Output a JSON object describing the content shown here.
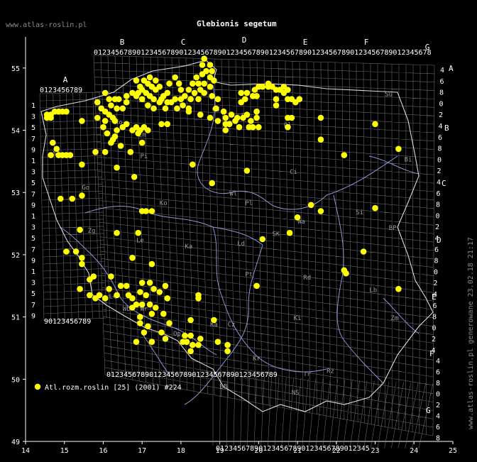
{
  "title": "Glebionis segetum",
  "site": "www.atlas-roslin.pl",
  "generated": "www.atlas-roslin.pl generowane 23.02.18 21:17",
  "legend_label": "Atl.rozm.roslin [25] (2001) #224",
  "colors": {
    "dot": "#ffff00",
    "grid": "#8a8a8a",
    "river": "#8c95d6",
    "border": "#ffffff"
  },
  "chart_data": {
    "type": "scatter",
    "xlim": [
      14,
      25
    ],
    "ylim": [
      49,
      55.5
    ],
    "x_ticks": [
      "14",
      "15",
      "16",
      "17",
      "18",
      "19",
      "20",
      "21",
      "22",
      "23",
      "24",
      "25"
    ],
    "y_ticks": [
      "49",
      "50",
      "51",
      "52",
      "53",
      "54",
      "55"
    ],
    "zones_top": [
      "A",
      "B",
      "C",
      "D",
      "E",
      "F",
      "G"
    ],
    "zones_right": [
      "A",
      "B",
      "C",
      "D",
      "E",
      "F",
      "G"
    ],
    "top_digits": "0123456789012345678901234567890123456789012345678901234567890123456789012345678",
    "bottom_digits_left": "0123456789012345678901234567890123456789",
    "bottom_digits_right": "012345678901234567890123456789012345",
    "a_digits": "0123456789",
    "a_bottom_digits": "90123456789",
    "left_row_labels": [
      "1",
      "3",
      "5",
      "7",
      "9",
      "1",
      "3",
      "5",
      "7",
      "9",
      "1",
      "3",
      "5",
      "7",
      "9",
      "1",
      "3",
      "5",
      "7",
      "9"
    ],
    "right_row_labels": [
      "4",
      "6",
      "8",
      "0",
      "2",
      "4",
      "6",
      "8",
      "0",
      "2",
      "4",
      "6",
      "8",
      "0",
      "2",
      "4",
      "6",
      "8",
      "0",
      "2",
      "4",
      "6",
      "8",
      "0",
      "2",
      "4"
    ],
    "right_bottom_labels": [
      "4",
      "6",
      "8",
      "0",
      "2",
      "4",
      "6",
      "8"
    ],
    "regions": [
      {
        "t": "Su",
        "x": 23.25,
        "y": 54.55
      },
      {
        "t": "Bi",
        "x": 23.75,
        "y": 53.5
      },
      {
        "t": "Ci",
        "x": 20.8,
        "y": 53.3
      },
      {
        "t": "Pi",
        "x": 16.95,
        "y": 53.55
      },
      {
        "t": "Ko",
        "x": 17.45,
        "y": 52.8
      },
      {
        "t": "Zg",
        "x": 15.6,
        "y": 52.35
      },
      {
        "t": "Le",
        "x": 16.85,
        "y": 52.2
      },
      {
        "t": "Ka",
        "x": 18.1,
        "y": 52.1
      },
      {
        "t": "Ld",
        "x": 19.45,
        "y": 52.15
      },
      {
        "t": "SK",
        "x": 20.35,
        "y": 52.3
      },
      {
        "t": "Si",
        "x": 22.5,
        "y": 52.65
      },
      {
        "t": "BP",
        "x": 23.35,
        "y": 52.4
      },
      {
        "t": "Pt",
        "x": 19.65,
        "y": 51.65
      },
      {
        "t": "Rd",
        "x": 21.15,
        "y": 51.6
      },
      {
        "t": "Lb",
        "x": 22.85,
        "y": 51.4
      },
      {
        "t": "Wb",
        "x": 16.5,
        "y": 51.1
      },
      {
        "t": "Ki",
        "x": 20.9,
        "y": 50.95
      },
      {
        "t": "Zm",
        "x": 23.4,
        "y": 50.95
      },
      {
        "t": "Tr",
        "x": 21.15,
        "y": 50.05
      },
      {
        "t": "Rz",
        "x": 21.75,
        "y": 50.1
      },
      {
        "t": "NS",
        "x": 20.85,
        "y": 49.75
      },
      {
        "t": "BB",
        "x": 19.0,
        "y": 49.85
      },
      {
        "t": "Gd",
        "x": 18.8,
        "y": 54.3
      },
      {
        "t": "El",
        "x": 19.55,
        "y": 54.2
      },
      {
        "t": "Ol",
        "x": 20.65,
        "y": 54.05
      },
      {
        "t": "Sz",
        "x": 14.7,
        "y": 53.6
      },
      {
        "t": "Go",
        "x": 15.45,
        "y": 53.05
      },
      {
        "t": "Wa",
        "x": 21.0,
        "y": 52.5
      },
      {
        "t": "Pl",
        "x": 19.65,
        "y": 52.8
      },
      {
        "t": "Wl",
        "x": 19.25,
        "y": 52.95
      },
      {
        "t": "Ka",
        "x": 18.75,
        "y": 50.85
      },
      {
        "t": "Kr",
        "x": 19.85,
        "y": 50.3
      },
      {
        "t": "Cz",
        "x": 19.2,
        "y": 50.85
      },
      {
        "t": "Op",
        "x": 17.8,
        "y": 50.7
      },
      {
        "t": "Wr",
        "x": 16.95,
        "y": 51.1
      },
      {
        "t": "Le",
        "x": 16.15,
        "y": 51.3
      },
      {
        "t": "Lm",
        "x": 16.9,
        "y": 53.9
      },
      {
        "t": "SI",
        "x": 16.9,
        "y": 54.45
      },
      {
        "t": "Ko",
        "x": 16.3,
        "y": 54.1
      }
    ],
    "points": [
      [
        14.75,
        54.3
      ],
      [
        14.55,
        54.25
      ],
      [
        14.65,
        54.25
      ],
      [
        14.85,
        54.3
      ],
      [
        14.95,
        54.3
      ],
      [
        15.05,
        54.3
      ],
      [
        14.55,
        54.2
      ],
      [
        14.65,
        54.2
      ],
      [
        14.7,
        53.8
      ],
      [
        14.8,
        53.7
      ],
      [
        14.65,
        53.6
      ],
      [
        14.85,
        53.6
      ],
      [
        14.95,
        53.6
      ],
      [
        15.05,
        53.6
      ],
      [
        15.15,
        53.6
      ],
      [
        15.45,
        54.15
      ],
      [
        15.85,
        54.45
      ],
      [
        15.8,
        53.65
      ],
      [
        15.45,
        53.45
      ],
      [
        14.9,
        52.9
      ],
      [
        15.2,
        52.9
      ],
      [
        15.45,
        52.95
      ],
      [
        16.05,
        54.6
      ],
      [
        16.15,
        54.5
      ],
      [
        16.3,
        54.5
      ],
      [
        16.4,
        54.5
      ],
      [
        16.2,
        54.4
      ],
      [
        16.35,
        54.35
      ],
      [
        16.5,
        54.35
      ],
      [
        16.6,
        54.45
      ],
      [
        16.6,
        54.55
      ],
      [
        16.75,
        54.6
      ],
      [
        16.85,
        54.55
      ],
      [
        16.95,
        54.7
      ],
      [
        16.85,
        54.8
      ],
      [
        17.05,
        54.8
      ],
      [
        17.2,
        54.85
      ],
      [
        17.15,
        54.75
      ],
      [
        17.0,
        54.65
      ],
      [
        17.25,
        54.7
      ],
      [
        17.35,
        54.8
      ],
      [
        17.35,
        54.65
      ],
      [
        17.45,
        54.7
      ],
      [
        17.55,
        54.55
      ],
      [
        17.65,
        54.6
      ],
      [
        17.7,
        54.75
      ],
      [
        17.85,
        54.85
      ],
      [
        17.95,
        54.75
      ],
      [
        18.0,
        54.65
      ],
      [
        18.1,
        54.55
      ],
      [
        18.2,
        54.65
      ],
      [
        18.3,
        54.75
      ],
      [
        18.35,
        54.6
      ],
      [
        18.45,
        54.75
      ],
      [
        18.4,
        54.85
      ],
      [
        18.55,
        54.9
      ],
      [
        18.55,
        55.05
      ],
      [
        18.65,
        54.95
      ],
      [
        18.75,
        54.85
      ],
      [
        18.6,
        54.75
      ],
      [
        18.5,
        54.65
      ],
      [
        18.45,
        54.5
      ],
      [
        18.25,
        54.5
      ],
      [
        18.0,
        54.5
      ],
      [
        17.85,
        54.5
      ],
      [
        17.75,
        54.45
      ],
      [
        17.65,
        54.45
      ],
      [
        17.5,
        54.5
      ],
      [
        17.3,
        54.5
      ],
      [
        17.2,
        54.55
      ],
      [
        17.1,
        54.6
      ],
      [
        16.9,
        54.6
      ],
      [
        17.0,
        54.5
      ],
      [
        17.15,
        54.4
      ],
      [
        17.3,
        54.35
      ],
      [
        17.45,
        54.45
      ],
      [
        17.6,
        54.35
      ],
      [
        17.9,
        54.35
      ],
      [
        18.05,
        54.4
      ],
      [
        18.2,
        54.35
      ],
      [
        18.6,
        55.15
      ],
      [
        18.75,
        55.05
      ],
      [
        18.8,
        54.95
      ],
      [
        18.85,
        54.8
      ],
      [
        18.75,
        54.7
      ],
      [
        18.6,
        54.6
      ],
      [
        18.8,
        54.55
      ],
      [
        18.95,
        54.5
      ],
      [
        18.9,
        54.35
      ],
      [
        18.5,
        54.25
      ],
      [
        18.2,
        54.3
      ],
      [
        18.75,
        54.2
      ],
      [
        18.95,
        54.15
      ],
      [
        19.1,
        54.3
      ],
      [
        19.15,
        54.2
      ],
      [
        19.25,
        54.1
      ],
      [
        19.3,
        54.25
      ],
      [
        19.4,
        54.15
      ],
      [
        19.5,
        54.05
      ],
      [
        19.45,
        54.2
      ],
      [
        19.6,
        54.2
      ],
      [
        19.7,
        54.25
      ],
      [
        19.8,
        54.15
      ],
      [
        19.85,
        54.05
      ],
      [
        19.95,
        54.2
      ],
      [
        19.95,
        54.3
      ],
      [
        19.55,
        54.45
      ],
      [
        19.55,
        54.6
      ],
      [
        19.7,
        54.6
      ],
      [
        19.65,
        54.5
      ],
      [
        19.15,
        54.0
      ],
      [
        19.15,
        54.1
      ],
      [
        19.75,
        54.05
      ],
      [
        20.0,
        54.05
      ],
      [
        19.95,
        54.55
      ],
      [
        19.9,
        54.65
      ],
      [
        19.85,
        54.55
      ],
      [
        20.0,
        54.7
      ],
      [
        20.1,
        54.7
      ],
      [
        20.25,
        54.7
      ],
      [
        20.25,
        54.75
      ],
      [
        20.35,
        54.7
      ],
      [
        20.45,
        54.65
      ],
      [
        20.55,
        54.65
      ],
      [
        20.65,
        54.7
      ],
      [
        20.75,
        54.65
      ],
      [
        20.65,
        54.6
      ],
      [
        20.45,
        54.5
      ],
      [
        20.75,
        54.5
      ],
      [
        20.85,
        54.5
      ],
      [
        21.05,
        54.5
      ],
      [
        20.45,
        54.4
      ],
      [
        20.75,
        54.2
      ],
      [
        20.85,
        54.2
      ],
      [
        20.95,
        54.45
      ],
      [
        20.75,
        54.05
      ],
      [
        21.6,
        54.2
      ],
      [
        21.6,
        53.85
      ],
      [
        22.2,
        53.6
      ],
      [
        23.0,
        54.1
      ],
      [
        23.6,
        53.7
      ],
      [
        22.2,
        51.75
      ],
      [
        22.25,
        51.7
      ],
      [
        22.7,
        52.05
      ],
      [
        23.6,
        51.45
      ],
      [
        23.0,
        52.75
      ],
      [
        21.35,
        52.8
      ],
      [
        21.6,
        52.7
      ],
      [
        21.0,
        52.6
      ],
      [
        20.8,
        52.35
      ],
      [
        20.1,
        52.25
      ],
      [
        19.7,
        53.35
      ],
      [
        18.8,
        53.15
      ],
      [
        18.3,
        53.45
      ],
      [
        17.25,
        52.7
      ],
      [
        17.1,
        52.7
      ],
      [
        17.0,
        52.7
      ],
      [
        16.8,
        53.25
      ],
      [
        16.35,
        53.4
      ],
      [
        16.05,
        53.65
      ],
      [
        16.2,
        53.8
      ],
      [
        16.3,
        53.9
      ],
      [
        16.35,
        54.0
      ],
      [
        16.5,
        54.05
      ],
      [
        16.6,
        54.1
      ],
      [
        16.75,
        54.0
      ],
      [
        16.85,
        54.05
      ],
      [
        16.95,
        54.0
      ],
      [
        17.05,
        54.05
      ],
      [
        17.15,
        54.0
      ],
      [
        16.9,
        53.95
      ],
      [
        17.0,
        53.8
      ],
      [
        16.7,
        53.65
      ],
      [
        16.45,
        53.75
      ],
      [
        16.25,
        53.85
      ],
      [
        16.1,
        53.95
      ],
      [
        16.0,
        54.05
      ],
      [
        16.05,
        54.15
      ],
      [
        16.15,
        54.25
      ],
      [
        16.25,
        54.2
      ],
      [
        16.3,
        54.15
      ],
      [
        15.85,
        54.2
      ],
      [
        15.95,
        54.35
      ],
      [
        16.05,
        54.3
      ],
      [
        17.5,
        54.1
      ],
      [
        17.65,
        54.1
      ],
      [
        16.9,
        52.35
      ],
      [
        16.75,
        51.95
      ],
      [
        17.25,
        51.85
      ],
      [
        16.45,
        51.5
      ],
      [
        16.6,
        51.5
      ],
      [
        17.0,
        51.55
      ],
      [
        17.2,
        51.55
      ],
      [
        17.3,
        51.45
      ],
      [
        17.45,
        51.4
      ],
      [
        17.6,
        51.5
      ],
      [
        17.65,
        51.3
      ],
      [
        17.1,
        51.35
      ],
      [
        16.95,
        51.4
      ],
      [
        16.75,
        51.3
      ],
      [
        16.65,
        51.35
      ],
      [
        16.85,
        51.2
      ],
      [
        16.75,
        51.15
      ],
      [
        17.0,
        51.2
      ],
      [
        17.2,
        51.2
      ],
      [
        17.35,
        51.15
      ],
      [
        16.95,
        51.0
      ],
      [
        17.25,
        51.05
      ],
      [
        17.55,
        51.05
      ],
      [
        17.7,
        50.9
      ],
      [
        17.5,
        50.75
      ],
      [
        17.15,
        50.85
      ],
      [
        16.95,
        50.9
      ],
      [
        17.05,
        50.75
      ],
      [
        17.6,
        50.65
      ],
      [
        17.25,
        50.6
      ],
      [
        16.85,
        50.6
      ],
      [
        18.05,
        50.6
      ],
      [
        18.1,
        50.7
      ],
      [
        18.25,
        50.7
      ],
      [
        18.15,
        50.6
      ],
      [
        18.3,
        50.55
      ],
      [
        18.25,
        50.45
      ],
      [
        18.45,
        50.55
      ],
      [
        18.5,
        50.65
      ],
      [
        18.25,
        50.95
      ],
      [
        18.45,
        51.3
      ],
      [
        18.45,
        51.35
      ],
      [
        18.85,
        50.95
      ],
      [
        18.95,
        50.6
      ],
      [
        19.2,
        50.55
      ],
      [
        19.2,
        50.45
      ],
      [
        19.95,
        51.5
      ],
      [
        15.05,
        52.05
      ],
      [
        15.3,
        52.05
      ],
      [
        15.45,
        51.85
      ],
      [
        15.45,
        51.95
      ],
      [
        15.4,
        51.45
      ],
      [
        15.65,
        51.6
      ],
      [
        15.75,
        51.65
      ],
      [
        15.65,
        51.35
      ],
      [
        15.8,
        51.3
      ],
      [
        16.05,
        51.3
      ],
      [
        16.15,
        51.45
      ],
      [
        16.35,
        51.35
      ],
      [
        15.9,
        51.35
      ],
      [
        15.4,
        52.4
      ],
      [
        16.35,
        52.35
      ],
      [
        16.2,
        51.65
      ]
    ]
  }
}
